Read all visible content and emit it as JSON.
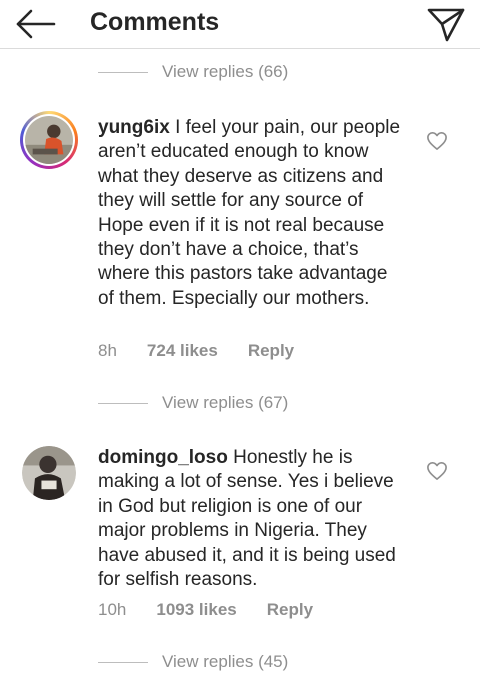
{
  "header": {
    "title": "Comments",
    "icons": {
      "back": "arrow-left-icon",
      "send": "paper-plane-icon"
    }
  },
  "top_view_replies": "View replies (66)",
  "comments": [
    {
      "username": "yung6ix",
      "text": "I feel your pain, our people aren’t educated enough to know what they deserve as citizens and they will settle for any source of Hope even if it is not real because they don’t have a choice, that’s where this pastors take advantage of them. Especially our mothers.",
      "time": "8h",
      "likes": "724 likes",
      "reply": "Reply",
      "view_replies": "View replies (67)"
    },
    {
      "username": "domingo_loso",
      "text": "Honestly he is making a lot of sense. Yes i believe in God but religion is one of our major problems in Nigeria. They have abused it, and it is being used for selfish reasons.",
      "time": "10h",
      "likes": "1093 likes",
      "reply": "Reply",
      "view_replies": "View replies (45)"
    }
  ],
  "colors": {
    "text": "#262626",
    "secondary": "#8e8e8e",
    "divider": "#dbdbdb"
  }
}
